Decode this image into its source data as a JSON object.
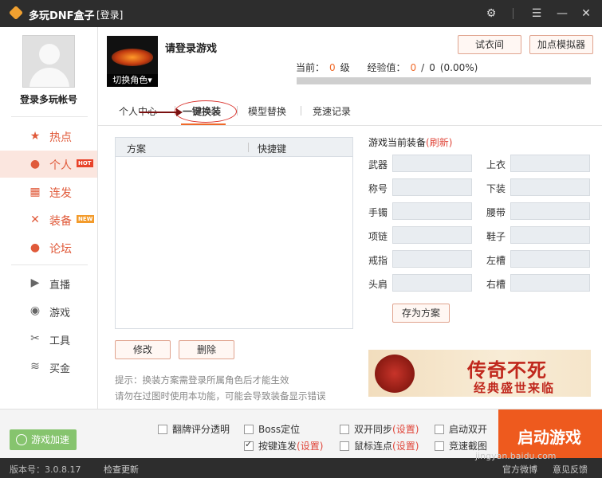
{
  "titlebar": {
    "app_name": "多玩DNF盒子",
    "login_link": "[登录]",
    "settings_icon": "gear-icon",
    "menu_icon": "hamburger-icon",
    "minimize_icon": "minimize-icon",
    "close_icon": "close-icon",
    "settings_glyph": "⚙",
    "menu_glyph": "☰",
    "minimize_glyph": "—",
    "close_glyph": "✕"
  },
  "sidebar": {
    "account_label": "登录多玩帐号",
    "items": [
      {
        "label": "热点",
        "icon": "star-icon",
        "glyph": "★"
      },
      {
        "label": "个人",
        "icon": "user-icon",
        "glyph": "●",
        "badge": "HOT"
      },
      {
        "label": "连发",
        "icon": "blocks-icon",
        "glyph": "▦"
      },
      {
        "label": "装备",
        "icon": "sword-icon",
        "glyph": "✕",
        "badge": "NEW"
      },
      {
        "label": "论坛",
        "icon": "chat-icon",
        "glyph": "●"
      },
      {
        "label": "直播",
        "icon": "play-icon",
        "glyph": "▶"
      },
      {
        "label": "游戏",
        "icon": "gamepad-icon",
        "glyph": "◉"
      },
      {
        "label": "工具",
        "icon": "tools-icon",
        "glyph": "✂"
      },
      {
        "label": "买金",
        "icon": "coins-icon",
        "glyph": "≋"
      }
    ]
  },
  "profile": {
    "switch_role": "切换角色▾",
    "prompt": "请登录游戏",
    "buttons": {
      "try_on": "试衣间",
      "add_emulator": "加点模拟器"
    },
    "level_label": "当前：",
    "level_value": "0",
    "level_unit": "级",
    "exp_label": "经验值：",
    "exp_current": "0",
    "exp_sep": "/",
    "exp_total": "0",
    "exp_percent": "(0.00%)",
    "exp_fraction": 0
  },
  "tabs": [
    "个人中心",
    "一键换装",
    "模型替换",
    "竞速记录"
  ],
  "plan_table": {
    "columns": [
      "方案",
      "快捷键"
    ],
    "rows": []
  },
  "plan_buttons": {
    "modify": "修改",
    "delete": "删除"
  },
  "tips": [
    "提示：换装方案需登录所属角色后才能生效",
    "请勿在过图时使用本功能，可能会导致装备显示错误"
  ],
  "equipment": {
    "title": "游戏当前装备",
    "refresh": "(刷新)",
    "left_slots": [
      "武器",
      "称号",
      "手镯",
      "项链",
      "戒指",
      "头肩"
    ],
    "right_slots": [
      "上衣",
      "下装",
      "腰带",
      "鞋子",
      "左槽",
      "右槽"
    ],
    "save_label": "存为方案"
  },
  "banner": {
    "title": "传奇不死",
    "subtitle": "经典盛世来临"
  },
  "bottom": {
    "accel_label": "游戏加速",
    "options_row1": [
      {
        "label": "翻牌评分透明",
        "checked": false
      },
      {
        "label": "Boss定位",
        "checked": false
      },
      {
        "label": "双开同步",
        "setting": "(设置)",
        "checked": false
      },
      {
        "label": "启动双开",
        "checked": false
      }
    ],
    "options_row2": [
      {
        "label": "按键连发",
        "setting": "(设置)",
        "checked": true
      },
      {
        "label": "鼠标连点",
        "setting": "(设置)",
        "checked": false
      },
      {
        "label": "竞速截图",
        "checked": false
      }
    ],
    "start_label": "启动游戏"
  },
  "statusbar": {
    "version": "版本号：3.0.8.17",
    "check_update": "检查更新",
    "weibo": "官方微博",
    "feedback": "意见反馈"
  },
  "watermark": "jingyan.baidu.com",
  "colors": {
    "accent": "#ee5a1e",
    "dark_bar": "#2d2d2d",
    "refresh_red": "#e0463a",
    "accel_green": "#86c46e"
  }
}
